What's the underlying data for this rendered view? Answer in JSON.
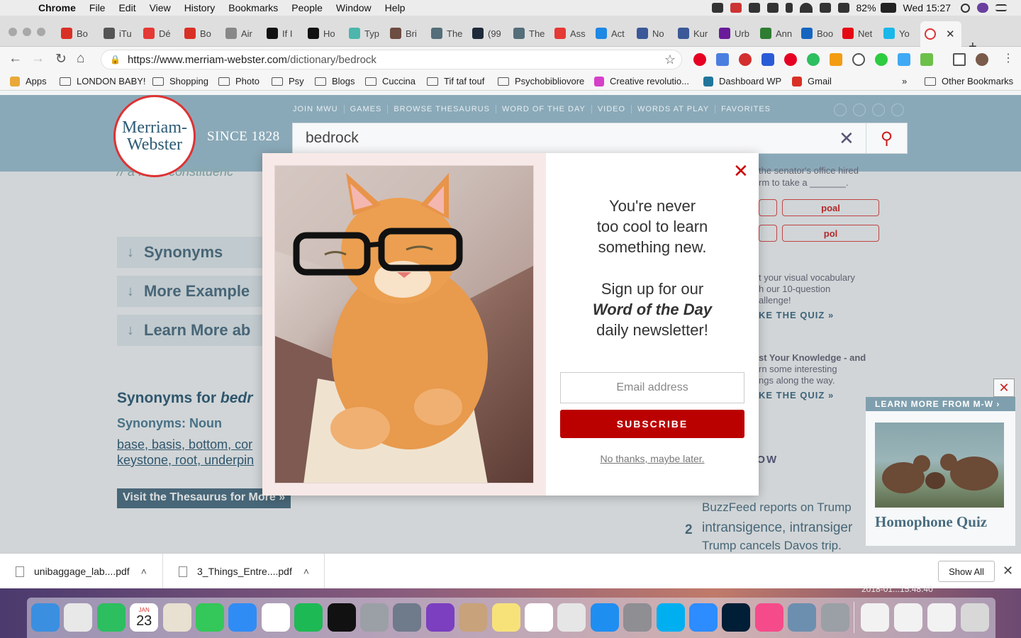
{
  "menubar": {
    "items": [
      "Chrome",
      "File",
      "Edit",
      "View",
      "History",
      "Bookmarks",
      "People",
      "Window",
      "Help"
    ],
    "battery": "82%",
    "clock": "Wed 15:27"
  },
  "tabs": [
    {
      "label": "Bo",
      "icon": "gmail-icon",
      "color": "#d93025"
    },
    {
      "label": "iTu",
      "icon": "apple-icon",
      "color": "#555555"
    },
    {
      "label": "Dé",
      "icon": "blogger-icon",
      "color": "#e53935"
    },
    {
      "label": "Bo",
      "icon": "gmail-icon",
      "color": "#d93025"
    },
    {
      "label": "Air",
      "icon": "page-icon",
      "color": "#888888"
    },
    {
      "label": "If I",
      "icon": "medium-icon",
      "color": "#111111"
    },
    {
      "label": "Ho",
      "icon": "medium-icon",
      "color": "#111111"
    },
    {
      "label": "Typ",
      "icon": "star-icon",
      "color": "#4db6ac"
    },
    {
      "label": "Bri",
      "icon": "bridge-icon",
      "color": "#6d4c41"
    },
    {
      "label": "The",
      "icon": "image-icon",
      "color": "#546e7a"
    },
    {
      "label": "(99",
      "icon": "tumblr-icon",
      "color": "#1e2a3a"
    },
    {
      "label": "The",
      "icon": "image-icon",
      "color": "#546e7a"
    },
    {
      "label": "Ass",
      "icon": "magnet-icon",
      "color": "#e53935"
    },
    {
      "label": "Act",
      "icon": "grid-icon",
      "color": "#1e88e5"
    },
    {
      "label": "No",
      "icon": "facebook-icon",
      "color": "#3b5998"
    },
    {
      "label": "Kur",
      "icon": "facebook-icon",
      "color": "#3b5998"
    },
    {
      "label": "Urb",
      "icon": "crown-icon",
      "color": "#6a1b9a"
    },
    {
      "label": "Ann",
      "icon": "font-icon",
      "color": "#2e7d32"
    },
    {
      "label": "Boo",
      "icon": "box-icon",
      "color": "#1565c0"
    },
    {
      "label": "Net",
      "icon": "netflix-icon",
      "color": "#e50914"
    },
    {
      "label": "Yo",
      "icon": "vimeo-icon",
      "color": "#1ab7ea"
    }
  ],
  "url": {
    "host": "https://www.merriam-webster.com",
    "path": "/dictionary/bedrock"
  },
  "bookmarks": [
    {
      "label": "Apps",
      "icon": "apps-icon"
    },
    {
      "label": "LONDON BABY!",
      "icon": "folder-icon"
    },
    {
      "label": "Shopping",
      "icon": "folder-icon"
    },
    {
      "label": "Photo",
      "icon": "folder-icon"
    },
    {
      "label": "Psy",
      "icon": "folder-icon"
    },
    {
      "label": "Blogs",
      "icon": "folder-icon"
    },
    {
      "label": "Cuccina",
      "icon": "folder-icon"
    },
    {
      "label": "Tif taf touf",
      "icon": "folder-icon"
    },
    {
      "label": "Psychobibliovore",
      "icon": "folder-icon"
    },
    {
      "label": "Creative revolutio...",
      "icon": "flower-icon"
    },
    {
      "label": "Dashboard WP",
      "icon": "wordpress-icon"
    },
    {
      "label": "Gmail",
      "icon": "gmail-icon"
    }
  ],
  "bookmarks_overflow": "»",
  "other_bookmarks": "Other Bookmarks",
  "site": {
    "logo_line1": "Merriam-",
    "logo_line2": "Webster",
    "since": "SINCE 1828",
    "nav": [
      "JOIN MWU",
      "GAMES",
      "BROWSE THESAURUS",
      "WORD OF THE DAY",
      "VIDEO",
      "WORDS AT PLAY",
      "FAVORITES"
    ],
    "search_value": "bedrock",
    "partial_example": "// a ... ck constituenc",
    "accordions": [
      "Synonyms",
      "More Example",
      "Learn More ab"
    ],
    "synonyms_title": "Synonyms for ",
    "synonyms_word": "bedr",
    "synonyms_sub": "Synonyms: Noun",
    "synonyms_line1": "base, basis, bottom, cor",
    "synonyms_line2": "keystone, root, underpin",
    "visit_button": "Visit the Thesaurus for More ",
    "right": {
      "quiz_text_top": "the senator's office hired",
      "quiz_text_top2": "rm to take a _______.",
      "pill1": "poal",
      "pill2": "pol",
      "vocab_text": "t your visual vocabulary",
      "vocab_text2": "h our 10-question",
      "vocab_text3": "allenge!",
      "quiz_link1": "KE THE QUIZ »",
      "know_text": "st Your Knowledge - and",
      "know_text2": "rn some interesting",
      "know_text3": "ngs along the way.",
      "quiz_link2": "KE THE QUIZ »",
      "trending": "NDING NOW",
      "trend1": "BuzzFeed reports on Trump",
      "trend2": "intransigence, intransiger",
      "trend2_num": "2",
      "trend3": "Trump cancels Davos trip."
    },
    "learn_more": {
      "header": "LEARN MORE FROM M-W ›",
      "title": "Homophone Quiz",
      "close": "✕"
    }
  },
  "modal": {
    "line1": "You're never",
    "line2": "too cool to learn",
    "line3": "something new.",
    "line4": "Sign up for our",
    "line5": "Word of the Day",
    "line6": "daily newsletter!",
    "email_placeholder": "Email address",
    "subscribe": "SUBSCRIBE",
    "decline": "No thanks, maybe later.",
    "close": "✕"
  },
  "downloads": [
    {
      "name": "unibaggage_lab....pdf"
    },
    {
      "name": "3_Things_Entre....pdf"
    }
  ],
  "downloads_show_all": "Show All",
  "desktop_stamp": "2018-01...15.48.40",
  "dock_icons": [
    "finder-icon",
    "chrome-icon",
    "evernote-icon",
    "calendar-icon",
    "vi-icon",
    "whatsapp-icon",
    "messages-icon",
    "pages-icon",
    "spotify-icon",
    "fingerprint-icon",
    "screenshot-icon",
    "launchpad-icon",
    "siri-icon",
    "contacts-icon",
    "notes-icon",
    "reminders-icon",
    "preview-icon",
    "appstore-icon",
    "system-prefs-icon",
    "skype-icon",
    "zoom-icon",
    "photoshop-icon",
    "itunes-icon",
    "photo-viewer-icon",
    "calculator-icon",
    "doc-icon",
    "doc-icon",
    "doc-icon",
    "trash-icon"
  ],
  "dock_calendar_day": "23",
  "dock_calendar_month": "JAN"
}
